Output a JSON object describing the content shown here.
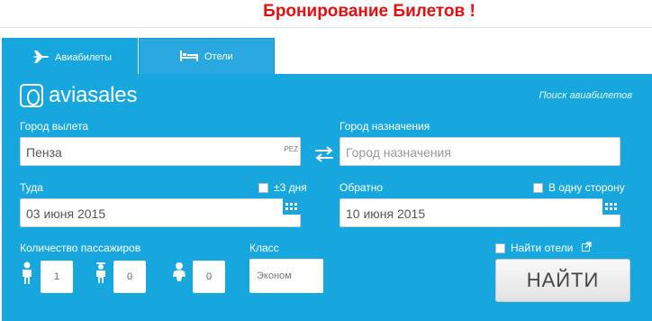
{
  "page": {
    "title": "Бронирование Билетов !"
  },
  "tabs": [
    {
      "label": "Авиабилеты",
      "icon": "airplane-icon",
      "active": true
    },
    {
      "label": "Отели",
      "icon": "bed-icon",
      "active": false
    }
  ],
  "widget": {
    "brand": "aviasales",
    "search_link": "Поиск авиабилетов"
  },
  "origin": {
    "label": "Город вылета",
    "value": "Пенза",
    "code": "PEZ"
  },
  "destination": {
    "label": "Город назначения",
    "placeholder": "Город назначения"
  },
  "depart": {
    "label": "Туда",
    "flex_label": "±3 дня",
    "flex_checked": false,
    "value": "03 июня 2015"
  },
  "return": {
    "label": "Обратно",
    "oneway_label": "В одну сторону",
    "oneway_checked": false,
    "value": "10 июня 2015"
  },
  "passengers": {
    "label": "Количество пассажиров",
    "adults": "1",
    "children": "0",
    "infants": "0"
  },
  "class": {
    "label": "Класс",
    "value": "Эконом"
  },
  "hotels": {
    "label": "Найти отели",
    "checked": false
  },
  "search_button": {
    "label": "НАЙТИ"
  },
  "colors": {
    "panel": "#16a7de",
    "title": "#e01010"
  }
}
